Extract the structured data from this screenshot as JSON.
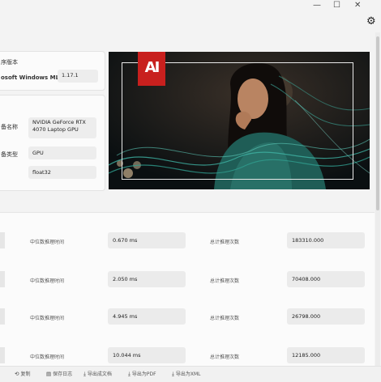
{
  "window": {
    "minimize": "—",
    "maximize": "☐",
    "close": "✕",
    "settings_icon": "⚙"
  },
  "version_card": {
    "label": "序版本",
    "runtime_name": "osoft Windows ML 版本",
    "runtime_version": "1.17.1"
  },
  "device_card": {
    "device_label": "备名称",
    "device_value": "NVIDIA GeForce RTX 4070 Laptop GPU",
    "type_label": "备类型",
    "type_value": "GPU",
    "precision_value": "float32"
  },
  "hero": {
    "logo_text": "AI"
  },
  "results": {
    "rows": [
      {
        "median_label": "中位数推理时间",
        "median_value": "0.670 ms",
        "total_label": "总计推理次数",
        "total_value": "183310.000"
      },
      {
        "median_label": "中位数推理时间",
        "median_value": "2.050 ms",
        "total_label": "总计推理次数",
        "total_value": "70408.000"
      },
      {
        "median_label": "中位数推理时间",
        "median_value": "4.945 ms",
        "total_label": "总计推理次数",
        "total_value": "26798.000"
      },
      {
        "median_label": "中位数推理时间",
        "median_value": "10.044 ms",
        "total_label": "总计推理次数",
        "total_value": "12185.000"
      }
    ]
  },
  "bottom_bar": {
    "items": [
      {
        "icon": "⟲",
        "label": "复制"
      },
      {
        "icon": "▤",
        "label": "保存日志"
      },
      {
        "icon": "⤓",
        "label": "导出成文档"
      },
      {
        "icon": "⤓",
        "label": "导出为PDF"
      },
      {
        "icon": "⤓",
        "label": "导出为XML"
      }
    ]
  }
}
